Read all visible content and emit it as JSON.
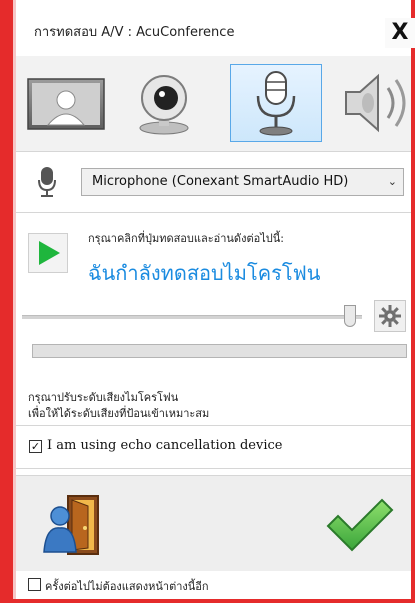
{
  "window": {
    "title": "การทดสอบ A/V : AcuConference",
    "close_label": "X"
  },
  "tabs": [
    {
      "name": "video-preview",
      "icon": "person-icon",
      "active": false
    },
    {
      "name": "webcam",
      "icon": "webcam-icon",
      "active": false
    },
    {
      "name": "microphone",
      "icon": "microphone-icon",
      "active": true
    },
    {
      "name": "speaker",
      "icon": "speaker-icon",
      "active": false
    }
  ],
  "device": {
    "icon": "microphone-icon",
    "selected": "Microphone (Conexant SmartAudio HD)"
  },
  "test": {
    "instruction": "กรุณาคลิกที่ปุ่มทดสอบและอ่านดังต่อไปนี้:",
    "phrase": "ฉันกำลังทดสอบไมโครโฟน",
    "slider_value": 0.95,
    "level_value": 0.0
  },
  "hint": {
    "line1": "กรุณาปรับระดับเสียงไมโครโฟน",
    "line2": "เพื่อให้ได้ระดับเสียงที่ป้อนเข้าเหมาะสม"
  },
  "echo": {
    "checked": true,
    "label": "I am using echo cancellation device"
  },
  "footer": {
    "checked": false,
    "label": "ครั้งต่อไปไม่ต้องแสดงหน้าต่างนี้อีก"
  },
  "colors": {
    "accent_blue": "#1a8be0",
    "play_green": "#1fb63d",
    "frame_red": "#e52b2b"
  }
}
